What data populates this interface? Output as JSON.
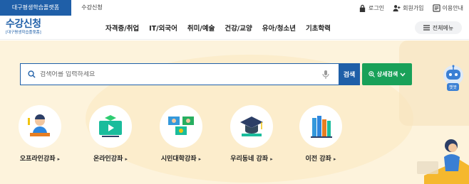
{
  "topbar": {
    "platform_tab": "대구평생학습플랫폼",
    "course_tab": "수강신청",
    "login": "로그인",
    "signup": "회원가입",
    "guide": "이용안내"
  },
  "header": {
    "logo_main": "수강신청",
    "logo_sub": "[대구평생학습플랫폼]",
    "nav": [
      "자격증/취업",
      "IT/외국어",
      "취미/예술",
      "건강/교양",
      "유아/청소년",
      "기초학력"
    ],
    "all_menu": "전체메뉴"
  },
  "search": {
    "placeholder": "검색어를 입력하세요",
    "button": "검색",
    "detail_button": "상세검색"
  },
  "categories": [
    {
      "label": "오프라인강좌"
    },
    {
      "label": "온라인강좌"
    },
    {
      "label": "시민대학강좌"
    },
    {
      "label": "우리동네 강좌"
    },
    {
      "label": "이전 강좌"
    }
  ],
  "chatbot": {
    "label": "챗봇"
  },
  "colors": {
    "brand_blue": "#1f5fa8",
    "green": "#19a159",
    "hero_bg": "#fdf3dc"
  }
}
